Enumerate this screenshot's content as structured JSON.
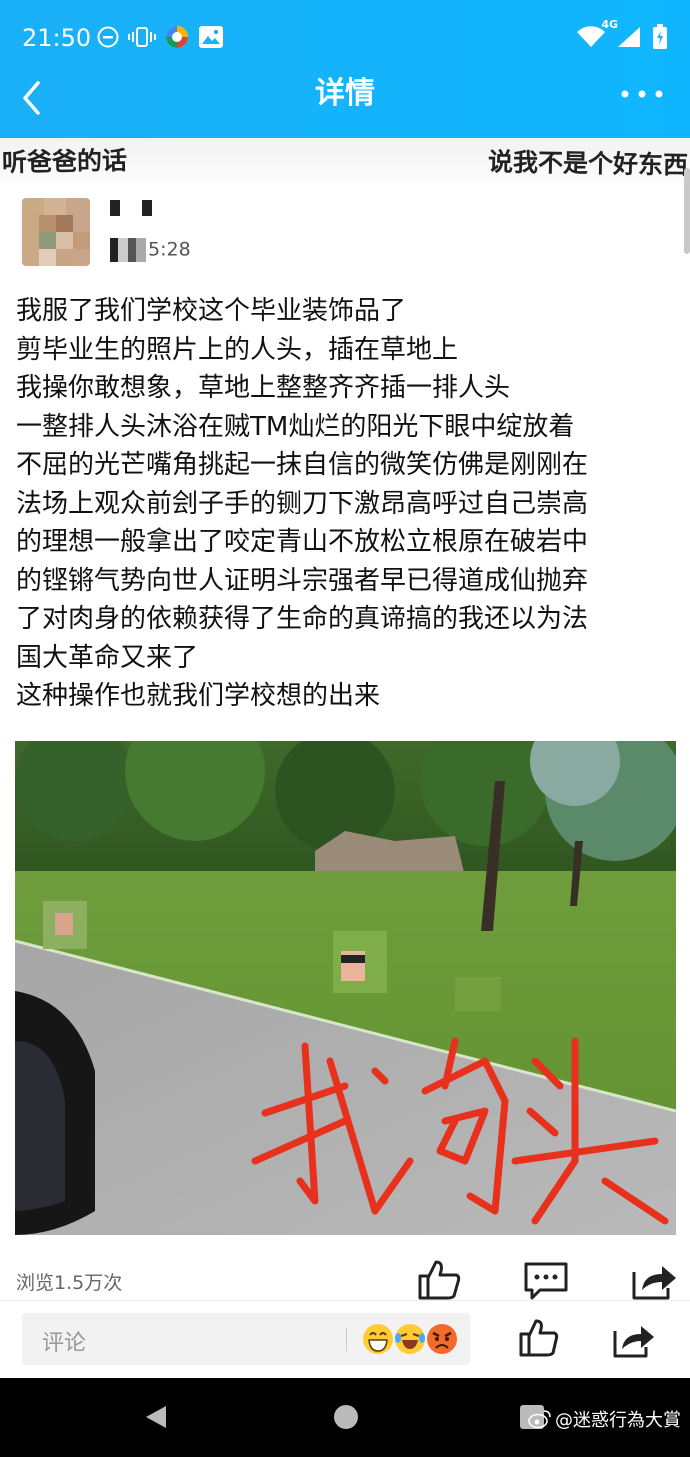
{
  "status_bar": {
    "time": "21:50",
    "network": "4G",
    "icons": [
      "minus-circle-icon",
      "vibrate-icon",
      "colorful-app-icon",
      "image-icon",
      "wifi-icon",
      "signal-icon",
      "battery-icon"
    ]
  },
  "app_bar": {
    "title": "详情",
    "back_icon": "chevron-left-icon",
    "more_icon": "more-dots-icon",
    "color": "#14b2fb"
  },
  "banner": {
    "left_text": "听爸爸的话",
    "right_text": "说我不是个好东西"
  },
  "post": {
    "username_masked": true,
    "time_suffix": "5:28",
    "lines": [
      "我服了我们学校这个毕业装饰品了",
      "剪毕业生的照片上的人头，插在草地上",
      "我操你敢想象，草地上整整齐齐插一排人头",
      "一整排人头沐浴在贼TM灿烂的阳光下眼中绽放着",
      "不屈的光芒嘴角挑起一抹自信的微笑仿佛是刚刚在",
      "法场上观众前刽子手的铡刀下激昂高呼过自己崇高",
      "的理想一般拿出了咬定青山不放松立根原在破岩中",
      "的铿锵气势向世人证明斗宗强者早已得道成仙抛弃",
      "了对肉身的依赖获得了生命的真谛搞的我还以为法",
      "国大革命又来了",
      "这种操作也就我们学校想的出来"
    ],
    "photo_caption": "我的头",
    "photo_caption_color": "#e8311c"
  },
  "meta": {
    "views": "浏览1.5万次",
    "icons": [
      "thumbs-up-icon",
      "comment-icon",
      "share-icon"
    ]
  },
  "comment_bar": {
    "placeholder": "评论",
    "emoji_icons": [
      "grin-emoji-icon",
      "laugh-tears-emoji-icon",
      "angry-emoji-icon"
    ]
  },
  "nav_bar": {
    "watermark": "@迷惑行為大賞"
  }
}
